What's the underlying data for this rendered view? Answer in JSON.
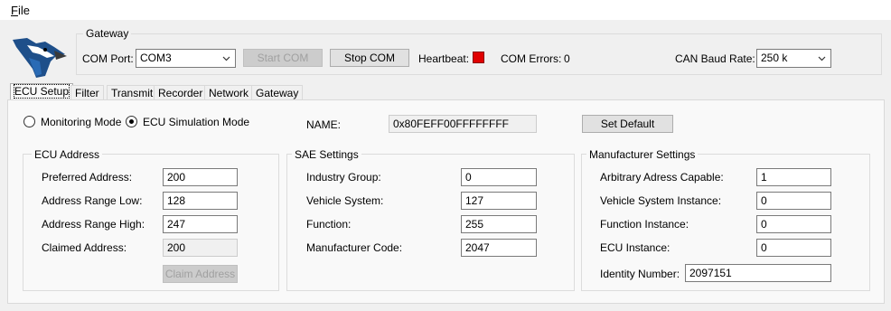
{
  "menu": {
    "file_first": "F",
    "file_rest": "ile"
  },
  "gateway": {
    "title": "Gateway",
    "com_port_label": "COM Port:",
    "com_port_value": "COM3",
    "start_com": "Start COM",
    "stop_com": "Stop COM",
    "heartbeat_label": "Heartbeat:",
    "heartbeat_color": "#e00000",
    "com_errors_label": "COM Errors:",
    "com_errors_value": "0",
    "baud_label": "CAN Baud Rate:",
    "baud_value": "250 k"
  },
  "tabs": [
    "ECU Setup",
    "Filter",
    "Transmit",
    "Recorder",
    "Network",
    "Gateway"
  ],
  "ecu_setup": {
    "monitoring_mode": "Monitoring Mode",
    "simulation_mode": "ECU Simulation Mode",
    "name_label": "NAME:",
    "name_value": "0x80FEFF00FFFFFFFF",
    "set_default": "Set Default",
    "ecu_address": {
      "title": "ECU Address",
      "preferred_label": "Preferred Address:",
      "preferred_value": "200",
      "range_low_label": "Address Range Low:",
      "range_low_value": "128",
      "range_high_label": "Address Range High:",
      "range_high_value": "247",
      "claimed_label": "Claimed Address:",
      "claimed_value": "200",
      "claim_button": "Claim Address"
    },
    "sae": {
      "title": "SAE Settings",
      "industry_label": "Industry Group:",
      "industry_value": "0",
      "vehicle_system_label": "Vehicle System:",
      "vehicle_system_value": "127",
      "function_label": "Function:",
      "function_value": "255",
      "manufacturer_label": "Manufacturer Code:",
      "manufacturer_value": "2047"
    },
    "manufacturer": {
      "title": "Manufacturer Settings",
      "arbitrary_label": "Arbitrary Adress Capable:",
      "arbitrary_value": "1",
      "vsi_label": "Vehicle System Instance:",
      "vsi_value": "0",
      "fi_label": "Function Instance:",
      "fi_value": "0",
      "ecu_instance_label": "ECU Instance:",
      "ecu_instance_value": "0",
      "identity_label": "Identity Number:",
      "identity_value": "2097151"
    }
  }
}
